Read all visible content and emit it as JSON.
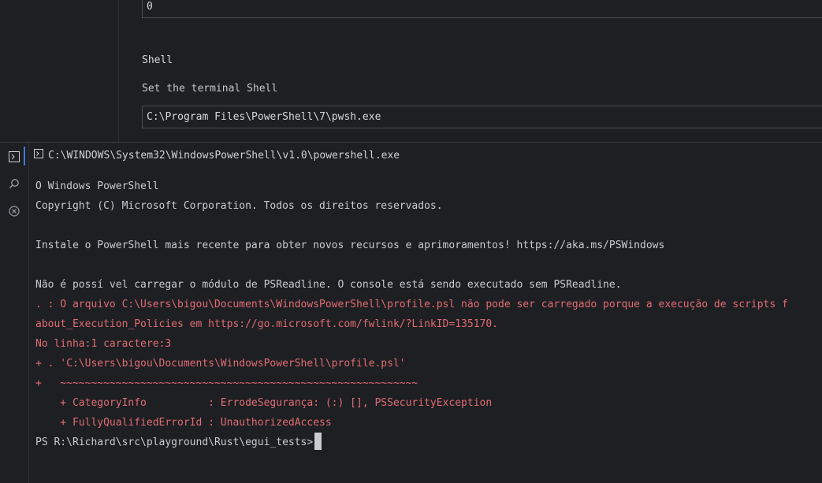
{
  "settings": {
    "previous_value": "0",
    "shell_title": "Shell",
    "shell_description": "Set the terminal Shell",
    "shell_value": "C:\\Program Files\\PowerShell\\7\\pwsh.exe"
  },
  "activity": {
    "items": [
      {
        "icon": "terminal-icon",
        "active": true
      },
      {
        "icon": "search-icon",
        "active": false
      },
      {
        "icon": "close-circle-icon",
        "active": false
      }
    ]
  },
  "terminal": {
    "title": "C:\\WINDOWS\\System32\\WindowsPowerShell\\v1.0\\powershell.exe",
    "lines": [
      {
        "text": "O Windows PowerShell",
        "kind": "normal"
      },
      {
        "text": "Copyright (C) Microsoft Corporation. Todos os direitos reservados.",
        "kind": "normal"
      },
      {
        "text": "",
        "kind": "normal"
      },
      {
        "text": "Instale o PowerShell mais recente para obter novos recursos e aprimoramentos! https://aka.ms/PSWindows",
        "kind": "normal"
      },
      {
        "text": "",
        "kind": "normal"
      },
      {
        "text": "Não é possí vel carregar o módulo de PSReadline. O console está sendo executado sem PSReadline.",
        "kind": "normal"
      },
      {
        "text": ". : O arquivo C:\\Users\\bigou\\Documents\\WindowsPowerShell\\profile.psl não pode ser carregado porque a execução de scripts f",
        "kind": "err"
      },
      {
        "text": "about_Execution_Policies em https://go.microsoft.com/fwlink/?LinkID=135170.",
        "kind": "err"
      },
      {
        "text": "No linha:1 caractere:3",
        "kind": "err"
      },
      {
        "text": "+ . 'C:\\Users\\bigou\\Documents\\WindowsPowerShell\\profile.psl'",
        "kind": "err"
      },
      {
        "text": "+   ~~~~~~~~~~~~~~~~~~~~~~~~~~~~~~~~~~~~~~~~~~~~~~~~~~~~~~~~~~",
        "kind": "err"
      },
      {
        "text": "    + CategoryInfo          : ErrodeSegurança: (:) [], PSSecurityException",
        "kind": "err"
      },
      {
        "text": "    + FullyQualifiedErrorId : UnauthorizedAccess",
        "kind": "err"
      }
    ],
    "prompt": "PS R:\\Richard\\src\\playground\\Rust\\egui_tests>"
  }
}
